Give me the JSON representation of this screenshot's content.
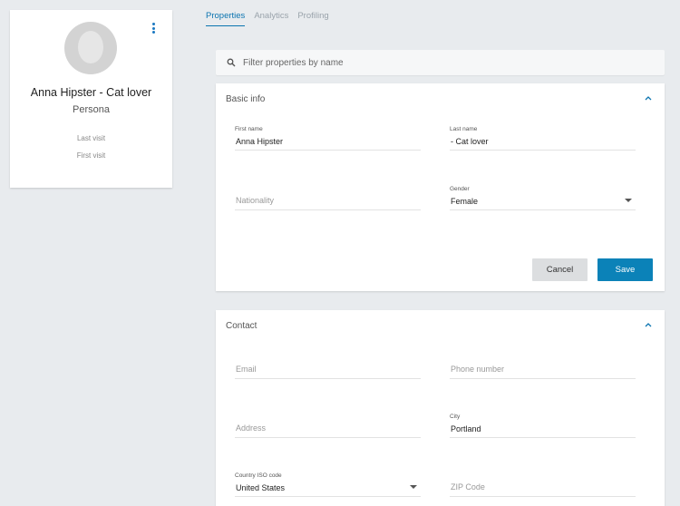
{
  "profile": {
    "name": "Anna Hipster - Cat lover",
    "role": "Persona",
    "last_visit_label": "Last visit",
    "first_visit_label": "First visit"
  },
  "tabs": [
    {
      "label": "Properties",
      "active": true
    },
    {
      "label": "Analytics",
      "active": false
    },
    {
      "label": "Profiling",
      "active": false
    }
  ],
  "filter": {
    "placeholder": "Filter properties by name"
  },
  "basic_info": {
    "title": "Basic info",
    "first_name": {
      "label": "First name",
      "value": "Anna Hipster"
    },
    "last_name": {
      "label": "Last name",
      "value": "- Cat lover"
    },
    "nationality": {
      "placeholder": "Nationality"
    },
    "gender": {
      "label": "Gender",
      "value": "Female"
    },
    "cancel_label": "Cancel",
    "save_label": "Save"
  },
  "contact": {
    "title": "Contact",
    "email": {
      "placeholder": "Email"
    },
    "phone": {
      "placeholder": "Phone number"
    },
    "address": {
      "placeholder": "Address"
    },
    "city": {
      "label": "City",
      "value": "Portland"
    },
    "country": {
      "label": "Country ISO code",
      "value": "United States"
    },
    "zip": {
      "placeholder": "ZIP Code"
    }
  },
  "colors": {
    "accent": "#0b82b8",
    "background": "#e8ebee"
  }
}
